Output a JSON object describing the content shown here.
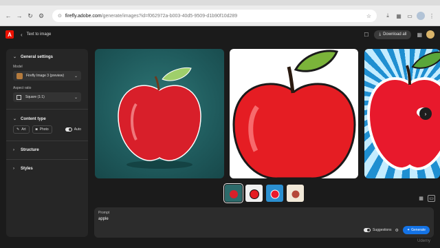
{
  "browser": {
    "url_prefix": "firefly.adobe.com",
    "url_rest": "/generate/images?id=f062972a-b003-40d5-9509-d1b90f10d289",
    "nav_icons": [
      "back-arrow-icon",
      "forward-arrow-icon",
      "reload-icon",
      "site-info-icon"
    ]
  },
  "appbar": {
    "back_label": "‹",
    "title": "Text to image",
    "download_label": "Download all"
  },
  "sidebar": {
    "general_settings": "General settings",
    "model_label": "Model",
    "model_value": "Firefly Image 3 (preview)",
    "aspect_label": "Aspect ratio",
    "aspect_value": "Square (1:1)",
    "content_type": "Content type",
    "art_label": "Art",
    "photo_label": "Photo",
    "auto_label": "Auto",
    "structure": "Structure",
    "styles": "Styles"
  },
  "prompt": {
    "label": "Prompt",
    "value": "apple",
    "suggestions_label": "Suggestions",
    "generate_label": "Generate"
  },
  "watermark": "Udemy",
  "colors": {
    "accent": "#1473e6",
    "adobe_red": "#eb1000",
    "background": "#1b1b1b",
    "panel": "#262626"
  }
}
